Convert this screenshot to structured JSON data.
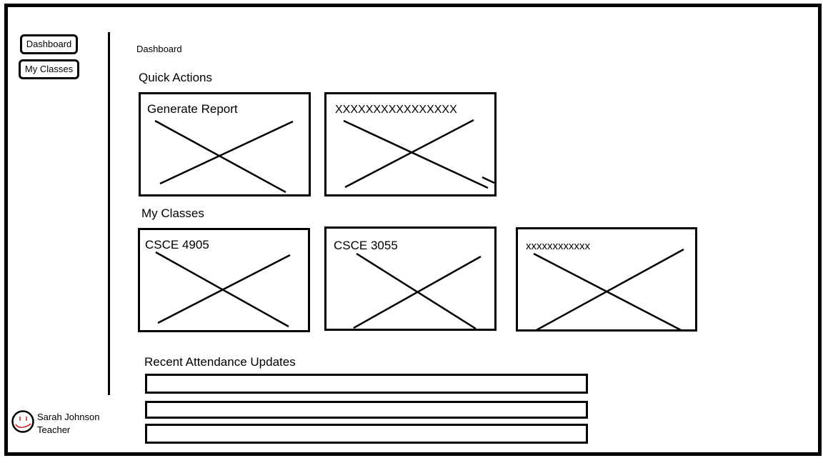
{
  "sidebar": {
    "items": [
      {
        "label": "Dashboard"
      },
      {
        "label": "My Classes"
      }
    ],
    "user": {
      "name": "Sarah Johnson",
      "role": "Teacher"
    }
  },
  "main": {
    "page_title": "Dashboard",
    "quick_actions": {
      "heading": "Quick Actions",
      "cards": [
        {
          "label": "Generate Report"
        },
        {
          "label": "XXXXXXXXXXXXXXXX"
        }
      ]
    },
    "my_classes": {
      "heading": "My Classes",
      "cards": [
        {
          "label": "CSCE 4905"
        },
        {
          "label": "CSCE 3055"
        },
        {
          "label": "xxxxxxxxxxxx"
        }
      ]
    },
    "recent_attendance": {
      "heading": "Recent Attendance Updates",
      "rows": [
        "",
        "",
        ""
      ]
    }
  }
}
